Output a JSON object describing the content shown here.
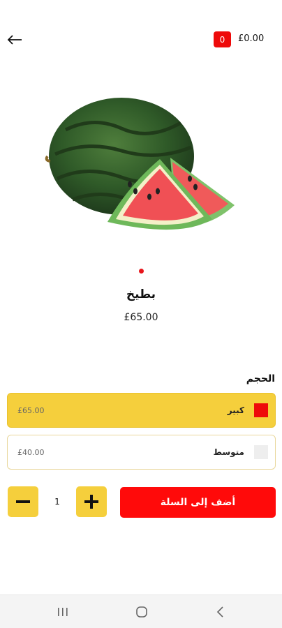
{
  "header": {
    "back_icon": "arrow-left-icon",
    "cart_total": "£0.00",
    "cart_count": "0"
  },
  "product": {
    "image": "watermelon-image",
    "name": "بطيخ",
    "price": "£65.00",
    "image_pages": 1,
    "current_page": 1
  },
  "size": {
    "title": "الحجم",
    "options": [
      {
        "label": "كبير",
        "price": "£65.00",
        "selected": true
      },
      {
        "label": "متوسط",
        "price": "£40.00",
        "selected": false
      }
    ]
  },
  "quantity": {
    "value": "1",
    "minus_icon": "minus-icon",
    "plus_icon": "plus-icon"
  },
  "add_to_cart": {
    "label": "أضف إلى السلة"
  },
  "system_nav": {
    "items": [
      "recent-apps-icon",
      "home-icon",
      "back-chevron-icon"
    ]
  },
  "colors": {
    "accent_red": "#ee0a0a",
    "accent_yellow": "#f5cf3c"
  }
}
